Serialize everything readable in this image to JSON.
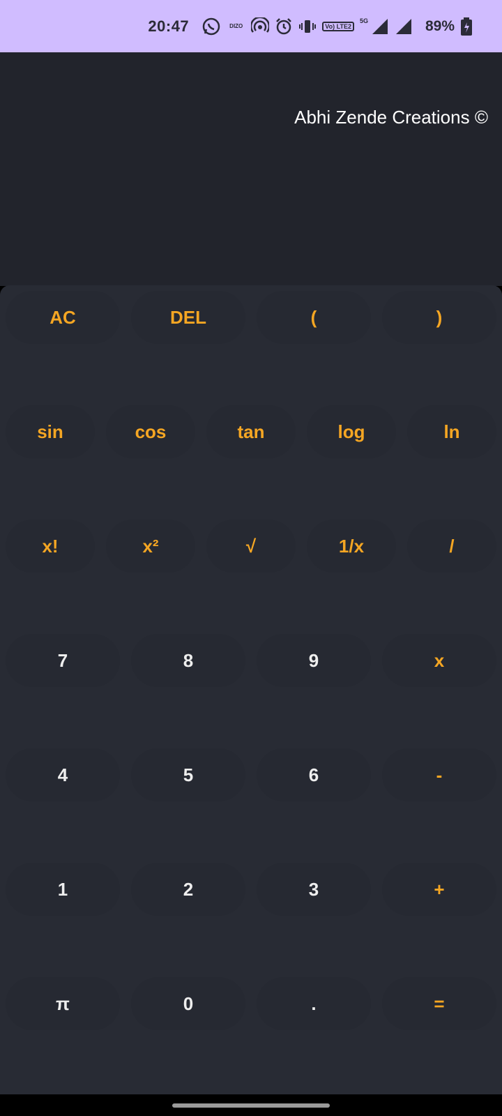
{
  "status_bar": {
    "time": "20:47",
    "brand_mini": "DIZO",
    "volte_label": "Vo) LTE2",
    "network": "5G",
    "battery": "89%"
  },
  "display": {
    "credit": "Abhi Zende Creations ©"
  },
  "keypad": {
    "row1": [
      "AC",
      "DEL",
      "(",
      ")"
    ],
    "row2": [
      "sin",
      "cos",
      "tan",
      "log",
      "ln"
    ],
    "row3": [
      "x!",
      "x²",
      "√",
      "1/x",
      "/"
    ],
    "row4": [
      "7",
      "8",
      "9",
      "x"
    ],
    "row5": [
      "4",
      "5",
      "6",
      "-"
    ],
    "row6": [
      "1",
      "2",
      "3",
      "+"
    ],
    "row7": [
      "π",
      "0",
      ".",
      "="
    ]
  },
  "colors": {
    "accent": "#f5a623",
    "keypad_bg": "#282b34",
    "display_bg": "#22242c",
    "status_bar_bg": "#d0bcff"
  }
}
